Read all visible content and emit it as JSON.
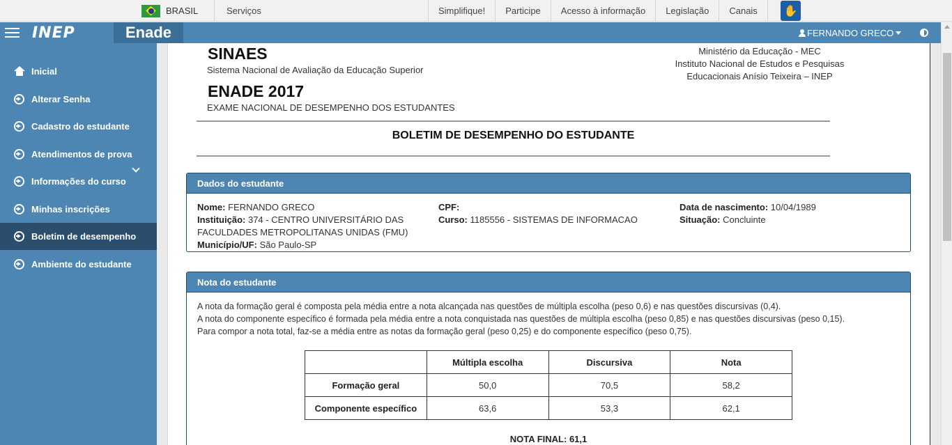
{
  "govbar": {
    "country": "BRASIL",
    "services": "Serviços",
    "links": [
      "Simplifique!",
      "Participe",
      "Acesso à informação",
      "Legislação",
      "Canais"
    ]
  },
  "header": {
    "logo": "INEP",
    "app_title": "Enade",
    "user": "FERNANDO GRECO"
  },
  "sidebar": {
    "items": [
      {
        "label": "Inicial",
        "icon": "home-icon"
      },
      {
        "label": "Alterar Senha",
        "icon": "circle-arrow-icon"
      },
      {
        "label": "Cadastro do estudante",
        "icon": "circle-arrow-icon"
      },
      {
        "label": "Atendimentos de prova",
        "icon": "circle-arrow-icon"
      },
      {
        "label": "Informações do curso",
        "icon": "circle-arrow-icon"
      },
      {
        "label": "Minhas inscrições",
        "icon": "circle-arrow-icon"
      },
      {
        "label": "Boletim de desempenho",
        "icon": "circle-arrow-icon",
        "active": true
      },
      {
        "label": "Ambiente do estudante",
        "icon": "circle-arrow-icon"
      }
    ]
  },
  "doc": {
    "sinaes": "SINAES",
    "sinaes_sub": "Sistema Nacional de Avaliação da Educação Superior",
    "enade_title": "ENADE 2017",
    "enade_sub": "EXAME NACIONAL DE DESEMPENHO DOS ESTUDANTES",
    "mec_lines": [
      "Ministério da Educação - MEC",
      "Instituto Nacional de Estudos e Pesquisas",
      "Educacionais Anísio Teixeira – INEP"
    ],
    "boletim_title": "BOLETIM DE DESEMPENHO DO ESTUDANTE"
  },
  "dados": {
    "title": "Dados do estudante",
    "nome_label": "Nome:",
    "nome": "FERNANDO GRECO",
    "instituicao_label": "Instituição:",
    "instituicao_line1": "374 - CENTRO UNIVERSITÁRIO DAS",
    "instituicao_line2": "FACULDADES METROPOLITANAS UNIDAS (FMU)",
    "municipio_label": "Município/UF:",
    "municipio": "São Paulo-SP",
    "cpf_label": "CPF:",
    "curso_label": "Curso:",
    "curso": "1185556 - SISTEMAS DE INFORMACAO",
    "nascimento_label": "Data de nascimento:",
    "nascimento": "10/04/1989",
    "situacao_label": "Situação:",
    "situacao": "Concluinte"
  },
  "nota": {
    "title": "Nota do estudante",
    "paragraphs": [
      "A nota da formação geral é composta pela média entre a nota alcançada nas questões de múltipla escolha (peso 0,6) e nas questões discursivas (0,4).",
      "A nota do componente específico é formada pela média entre a nota conquistada nas questões de múltipla escolha (peso 0,85) e nas questões discursivas (peso 0,15).",
      "Para compor a nota total, faz-se a média entre as notas da formação geral (peso 0,25) e do componente específico (peso 0,75)."
    ],
    "table": {
      "headers": [
        "",
        "Múltipla escolha",
        "Discursiva",
        "Nota"
      ],
      "rows": [
        {
          "label": "Formação geral",
          "cells": [
            "50,0",
            "70,5",
            "58,2"
          ]
        },
        {
          "label": "Componente específico",
          "cells": [
            "63,6",
            "53,3",
            "62,1"
          ]
        }
      ]
    },
    "total": "NOTA FINAL: 61,1"
  }
}
